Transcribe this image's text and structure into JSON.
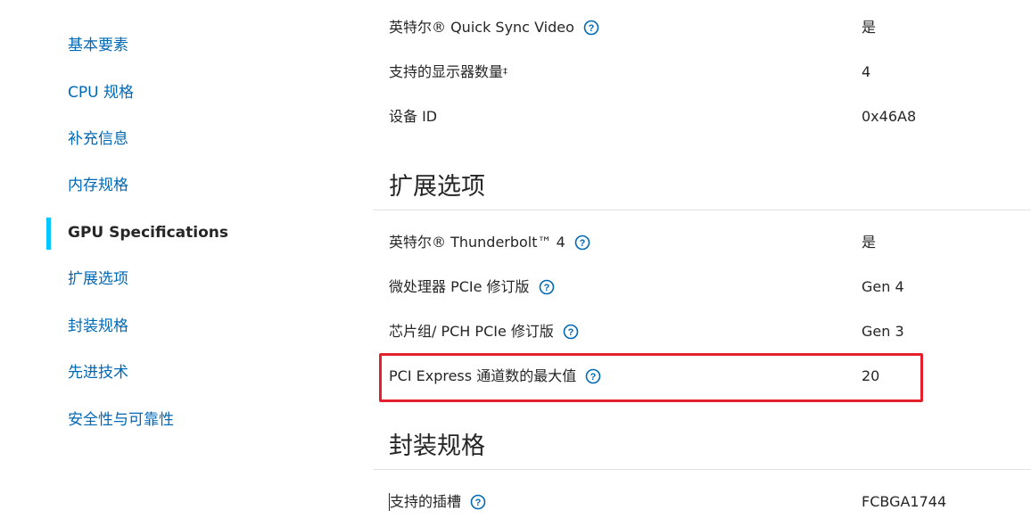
{
  "sidebar": {
    "items": [
      {
        "label": "基本要素",
        "active": false
      },
      {
        "label": "CPU 规格",
        "active": false
      },
      {
        "label": "补充信息",
        "active": false
      },
      {
        "label": "内存规格",
        "active": false
      },
      {
        "label": "GPU Specifications",
        "active": true
      },
      {
        "label": "扩展选项",
        "active": false
      },
      {
        "label": "封装规格",
        "active": false
      },
      {
        "label": "先进技术",
        "active": false
      },
      {
        "label": "安全性与可靠性",
        "active": false
      }
    ]
  },
  "gpu_rows": [
    {
      "label": "英特尔® Quick Sync Video",
      "value": "是",
      "help": true
    },
    {
      "label": "支持的显示器数量",
      "value": "4",
      "help": false,
      "footnote": "‡"
    },
    {
      "label": "设备 ID",
      "value": "0x46A8",
      "help": false
    }
  ],
  "expansion": {
    "title": "扩展选项",
    "rows": [
      {
        "label": "英特尔® Thunderbolt™ 4",
        "value": "是",
        "help": true
      },
      {
        "label": "微处理器 PCIe 修订版",
        "value": "Gen 4",
        "help": true
      },
      {
        "label": "芯片组/ PCH PCIe 修订版",
        "value": "Gen 3",
        "help": true
      },
      {
        "label": "PCI Express 通道数的最大值",
        "value": "20",
        "help": true,
        "highlighted": true
      }
    ]
  },
  "package": {
    "title": "封装规格",
    "rows": [
      {
        "label": "支持的插槽",
        "value": "FCBGA1744",
        "help": true
      }
    ]
  },
  "colors": {
    "link": "#0068b5",
    "active_indicator": "#00c7fd",
    "highlight_border": "#e3202b",
    "text": "#262626"
  },
  "icons": {
    "help": "question-circle-icon"
  }
}
